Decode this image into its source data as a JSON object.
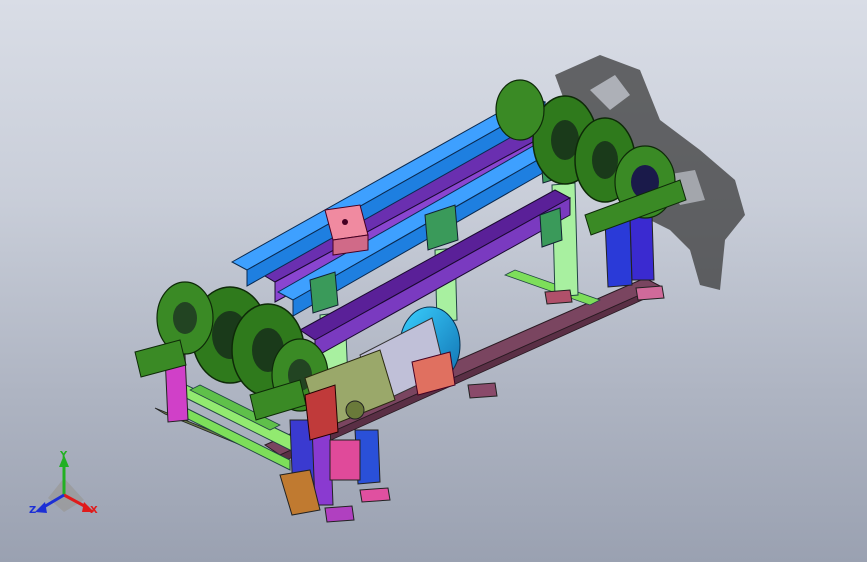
{
  "triad": {
    "x_label": "X",
    "y_label": "Y",
    "z_label": "Z",
    "x_color": "#e01b1b",
    "y_color": "#22b022",
    "z_color": "#1c2fd6"
  },
  "colors": {
    "background_top": "#d9dde6",
    "background_bottom": "#9aa1b1",
    "beam_blue": "#1e7fe0",
    "beam_purple": "#6a2fb0",
    "sprocket_green": "#2f7a1c",
    "frame_green": "#7dde5a",
    "motor_blue": "#1aa3e0",
    "gearbox_olive": "#9aa86a",
    "pink_block": "#f08aa0",
    "mauve_rail": "#7a4560",
    "shadow": "#3a3a3a"
  },
  "model": {
    "name_icon": "conveyor-assembly-icon",
    "parts": [
      "sprocket-shaft-assembly",
      "upper-conveyor-beams",
      "pillow-block-bearings",
      "support-frame",
      "gear-motor",
      "base-rails"
    ]
  }
}
